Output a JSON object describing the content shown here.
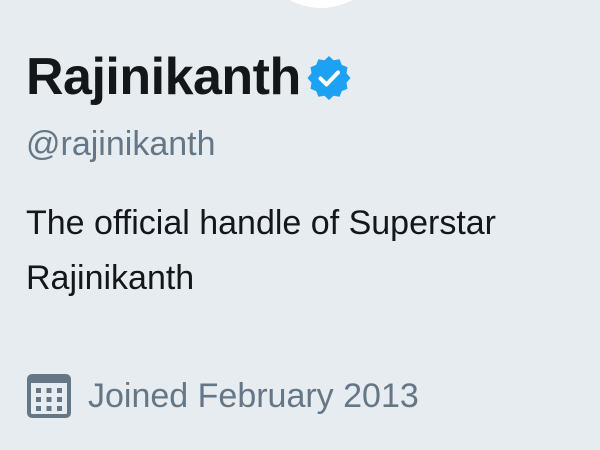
{
  "profile": {
    "display_name": "Rajinikanth",
    "verified_icon": "verified-badge-icon",
    "handle": "@rajinikanth",
    "bio": "The official handle of Superstar Rajinikanth",
    "joined_icon": "calendar-icon",
    "joined": "Joined February 2013"
  },
  "colors": {
    "background": "#e6ecf0",
    "name": "#14171a",
    "muted": "#657786",
    "verified": "#1da1f2"
  }
}
